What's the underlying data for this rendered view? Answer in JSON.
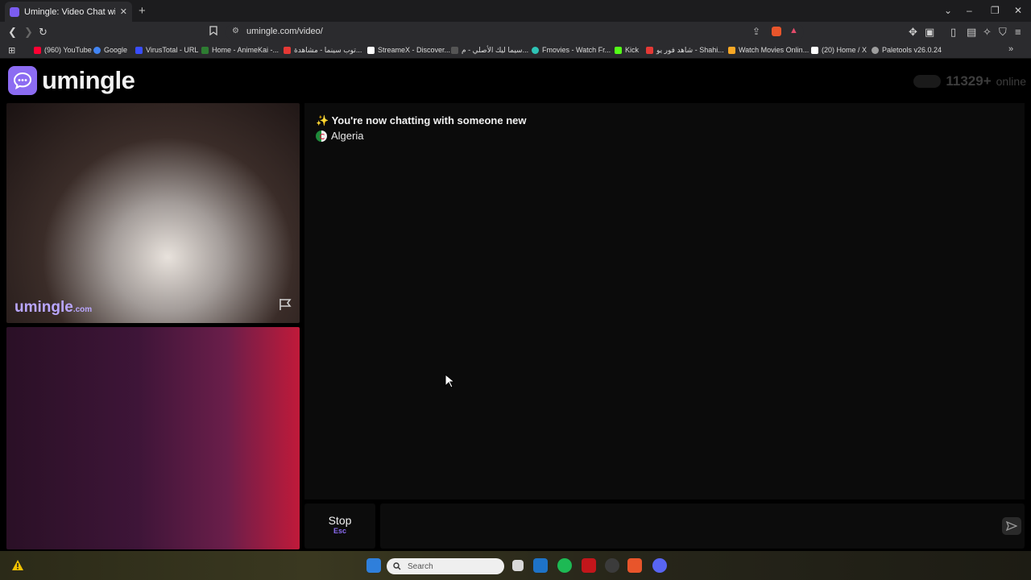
{
  "browser": {
    "tab_title": "Umingle: Video Chat with Str",
    "url": "umingle.com/video/",
    "bookmarks": [
      {
        "label": "(960) YouTube",
        "color": "#ff0033"
      },
      {
        "label": "Google",
        "color": "#4285f4"
      },
      {
        "label": "VirusTotal - URL",
        "color": "#394eff"
      },
      {
        "label": "Home - AnimeKai -...",
        "color": "#2e7d32"
      },
      {
        "label": "توب سينما - مشاهدة...",
        "color": "#e53935"
      },
      {
        "label": "StreameX - Discover...",
        "color": "#ffffff"
      },
      {
        "label": "سيما ليك الأصلي - م...",
        "color": "#555555"
      },
      {
        "label": "Fmovies - Watch Fr...",
        "color": "#2ec4b6"
      },
      {
        "label": "Kick",
        "color": "#53fc18"
      },
      {
        "label": "شاهد فور يو - Shahi...",
        "color": "#e53935"
      },
      {
        "label": "Watch Movies Onlin...",
        "color": "#f9a825"
      },
      {
        "label": "(20) Home / X",
        "color": "#ffffff"
      },
      {
        "label": "Paletools v26.0.24",
        "color": "#9e9e9e"
      }
    ]
  },
  "header": {
    "logo_text": "umingle",
    "online_count": "11329+",
    "online_label": "online"
  },
  "video": {
    "watermark": "umingle",
    "watermark_suffix": ".com"
  },
  "chat": {
    "new_chat_message": "✨ You're now chatting with someone new",
    "country": "Algeria"
  },
  "controls": {
    "stop_label": "Stop",
    "stop_key": "Esc",
    "input_placeholder": ""
  },
  "taskbar": {
    "search_placeholder": "Search"
  },
  "colors": {
    "brand": "#8c6cf2",
    "chat_bg": "#0b0b0b"
  }
}
